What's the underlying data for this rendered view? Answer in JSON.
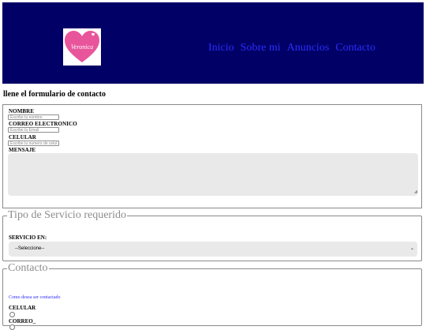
{
  "header": {
    "logo_text": "Veronica",
    "nav": [
      "Inicio",
      "Sobre mi",
      "Anuncios",
      "Contacto"
    ]
  },
  "form": {
    "title": "llene el formulario de contacto",
    "nombre_label": "NOMBRE",
    "nombre_placeholder": "Escribe tu nombre",
    "correo_label": "CORREO ELECTRONICO",
    "correo_placeholder": "Escribe tu Email",
    "celular_label": "CELULAR",
    "celular_placeholder": "Escribe tu numero de celular",
    "mensaje_label": "MENSAJE"
  },
  "servicio": {
    "legend": "Tipo de Servicio requerido",
    "label": "SERVICIO EN:",
    "selected": "--Seleccione--"
  },
  "contacto": {
    "legend": "Contacto",
    "hint": "Como desea ser contactado",
    "options": [
      "CELULAR",
      "CORREO_"
    ]
  },
  "colors": {
    "header_bg": "#000066",
    "nav_link": "#2c2cff",
    "logo_pink": "#e8559b"
  }
}
